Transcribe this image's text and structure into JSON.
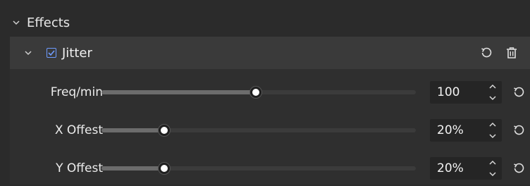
{
  "effects_section": {
    "title": "Effects",
    "expanded": true
  },
  "effect": {
    "name": "Jitter",
    "enabled": true,
    "expanded": true,
    "accent_color": "#6e9bff"
  },
  "params": [
    {
      "label": "Freq/min",
      "value": "100",
      "slider_fraction": 0.49
    },
    {
      "label": "X Offest",
      "value": "20%",
      "slider_fraction": 0.2
    },
    {
      "label": "Y Offest",
      "value": "20%",
      "slider_fraction": 0.2
    }
  ],
  "icons": {
    "collapse": "chevron-down-icon",
    "checkbox": "checkbox-checked-icon",
    "reset": "reset-icon",
    "delete": "trash-icon",
    "stepper": "stepper-icon"
  }
}
